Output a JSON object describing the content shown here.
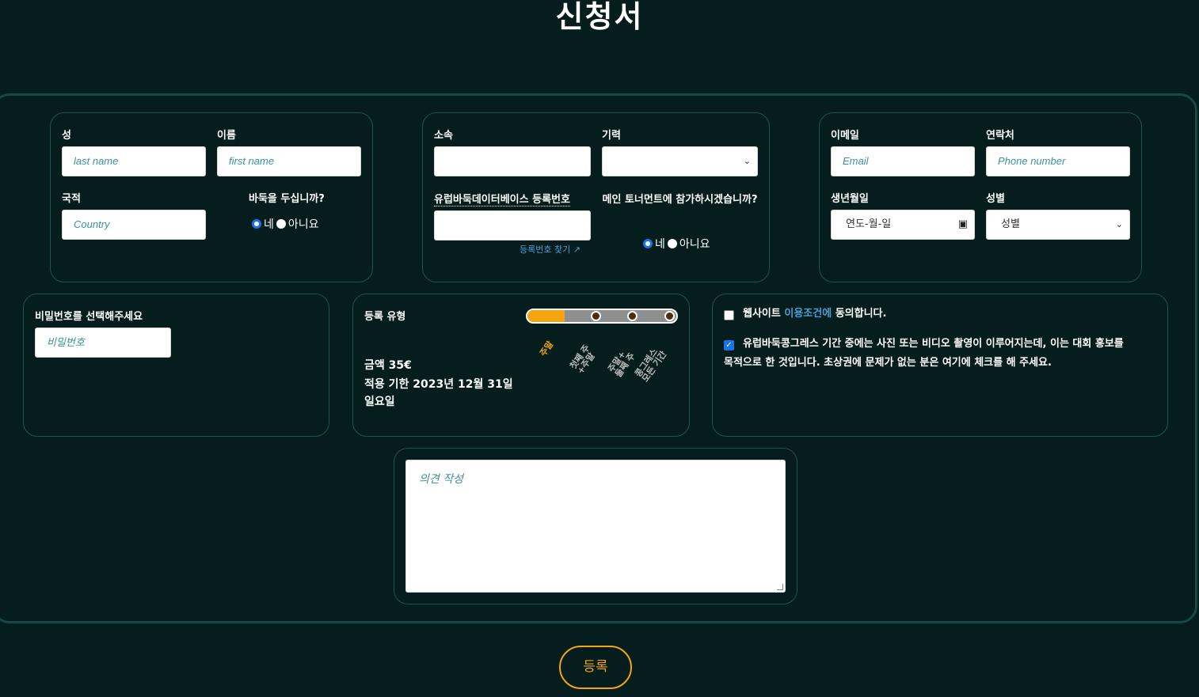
{
  "title": "신청서",
  "personal": {
    "last_name_label": "성",
    "last_name_placeholder": "last name",
    "first_name_label": "이름",
    "first_name_placeholder": "first name",
    "country_label": "국적",
    "country_placeholder": "Country",
    "plays_go_label": "바둑을 두십니까?",
    "yes": "네",
    "no": "아니요"
  },
  "club": {
    "club_label": "소속",
    "rank_label": "기력",
    "egd_label": "유럽바둑데이터베이스 등록번호",
    "egd_link": "등록번호 찾기",
    "main_tournament_label": "메인 토너먼트에 참가하시겠습니까?",
    "yes": "네",
    "no": "아니요"
  },
  "contact": {
    "email_label": "이메일",
    "email_placeholder": "Email",
    "phone_label": "연락처",
    "phone_placeholder": "Phone number",
    "birthdate_label": "생년월일",
    "birthdate_placeholder": "연도-월-일",
    "gender_label": "성별",
    "gender_selected": "성별"
  },
  "password": {
    "label": "비밀번호를 선택해주세요",
    "placeholder": "비밀번호"
  },
  "registration": {
    "label": "등록 유형",
    "options": [
      "주말",
      "첫째 주\n+주말",
      "주말+\n둘째 주",
      "콩그레스\n모든 기간"
    ],
    "selected_index": 0,
    "price_line": "금액 35€",
    "deadline_line1": "적용 기한 2023년 12월 31일",
    "deadline_line2": "일요일"
  },
  "consent": {
    "terms_prefix": "웹사이트 ",
    "terms_link": "이용조건에",
    "terms_suffix": " 동의합니다.",
    "terms_checked": false,
    "photo_line1": "유럽바둑콩그레스 기간 중에는 사진 또는 비디오 촬영이 이루어지는데, 이는 대회 홍보를",
    "photo_line2": "목적으로 한 것입니다. 초상권에 문제가 없는 분은 여기에 체크를 해 주세요.",
    "photo_checked": true
  },
  "comment": {
    "placeholder": "의견 작성"
  },
  "submit_label": "등록",
  "colors": {
    "accent": "#f5a50f",
    "background": "#061d1d",
    "border": "#1f5252",
    "link": "#4a9fd6"
  }
}
